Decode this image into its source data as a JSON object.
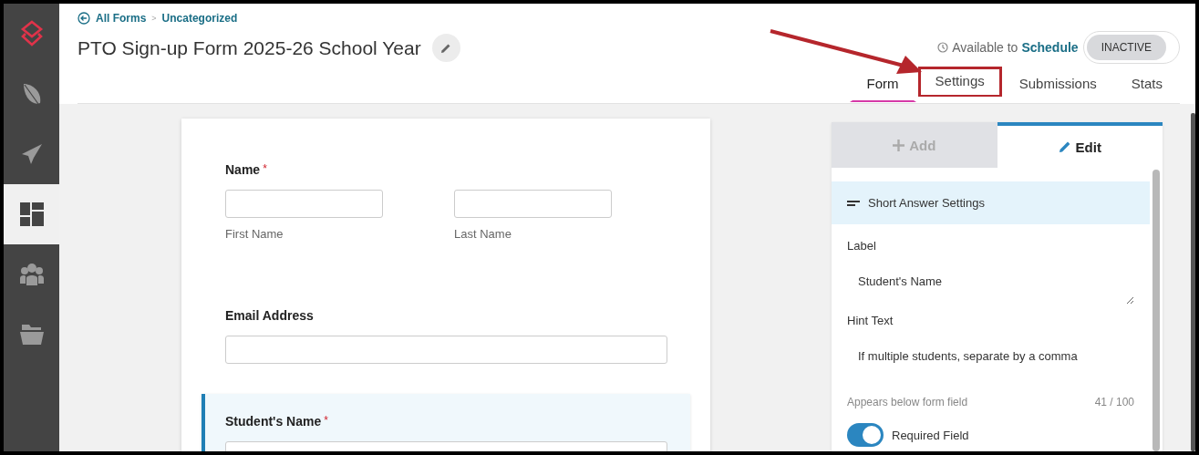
{
  "sidebar": {
    "items": [
      {
        "kind": "logo",
        "selected": false
      },
      {
        "kind": "feather",
        "selected": false
      },
      {
        "kind": "plane",
        "selected": false
      },
      {
        "kind": "dashboard",
        "selected": true
      },
      {
        "kind": "team",
        "selected": false
      },
      {
        "kind": "folder",
        "selected": false
      }
    ]
  },
  "breadcrumb": {
    "items": [
      "All Forms",
      "Uncategorized"
    ],
    "separator": ">"
  },
  "title": "PTO Sign-up Form 2025-26 School Year",
  "availability": {
    "text": "Available to",
    "link": "Schedule"
  },
  "status_toggle": {
    "label": "INACTIVE",
    "on": false
  },
  "tabs": [
    {
      "label": "Form",
      "selected": true,
      "highlighted": false
    },
    {
      "label": "Settings",
      "selected": false,
      "highlighted": true
    },
    {
      "label": "Submissions",
      "selected": false,
      "highlighted": false
    },
    {
      "label": "Stats",
      "selected": false,
      "highlighted": false
    }
  ],
  "form": {
    "fields": [
      {
        "kind": "name",
        "label": "Name",
        "required_mark": "*",
        "selected": false,
        "sublabels": [
          "First Name",
          "Last Name"
        ]
      },
      {
        "kind": "text",
        "label": "Email Address",
        "selected": false
      },
      {
        "kind": "text",
        "label": "Student's Name",
        "required_mark": "*",
        "selected": true
      }
    ]
  },
  "panel": {
    "tabs": [
      {
        "label": "Add",
        "kind": "add",
        "selected": false
      },
      {
        "label": "Edit",
        "kind": "edit",
        "selected": true
      }
    ],
    "section": "Short Answer Settings",
    "label_field": {
      "label": "Label",
      "value": "Student's Name"
    },
    "hint_field": {
      "label": "Hint Text",
      "value": "If multiple students, separate by a comma",
      "note": "Appears below form field",
      "count": "41 / 100"
    },
    "required_toggle": {
      "label": "Required Field",
      "on": true
    }
  }
}
